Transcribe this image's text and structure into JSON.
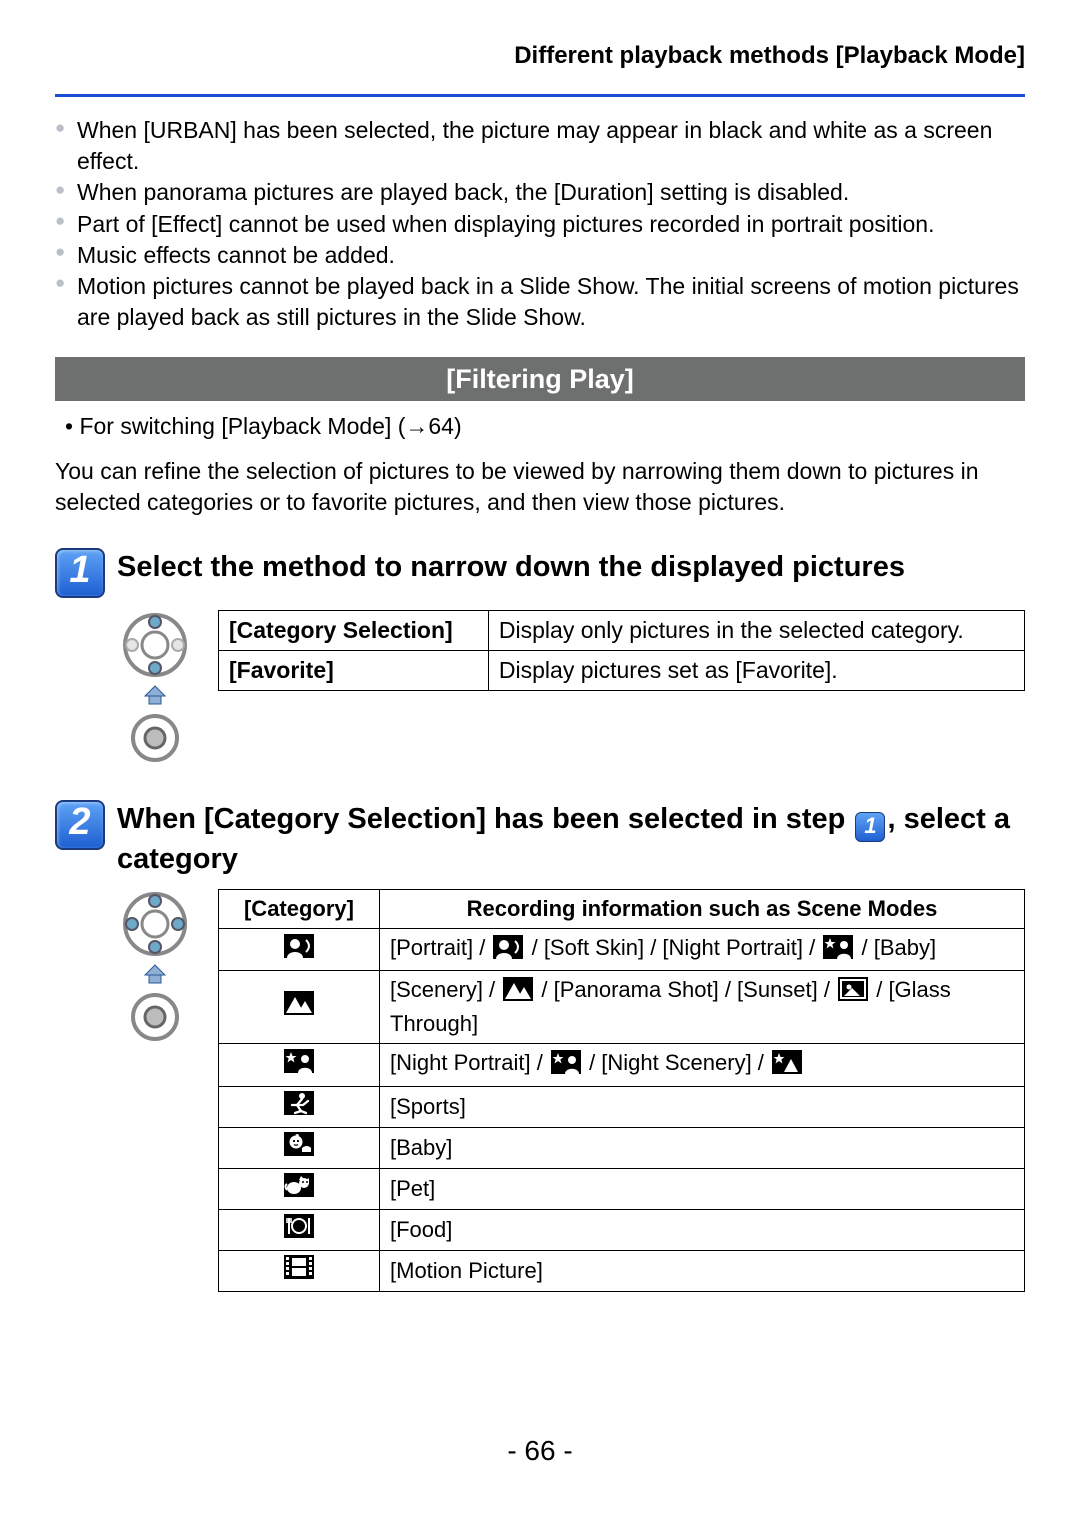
{
  "header": "Different playback methods  [Playback Mode]",
  "bullets": [
    "When [URBAN] has been selected, the picture may appear in black and white as a screen effect.",
    "When panorama pictures are played back, the [Duration] setting is disabled.",
    "Part of [Effect] cannot be used when displaying pictures recorded in portrait position.",
    "Music effects cannot be added.",
    "Motion pictures cannot be played back in a Slide Show. The initial screens of motion pictures are played back as still pictures in the Slide Show."
  ],
  "section_title": "[Filtering Play]",
  "sub_note": "• For switching [Playback Mode] (→64)",
  "intro_para": "You can refine the selection of pictures to be viewed by narrowing them down to pictures in selected categories or to favorite pictures, and then view those pictures.",
  "step1": {
    "num": "1",
    "title": "Select the method to narrow down the displayed pictures",
    "rows": [
      {
        "label": "[Category Selection]",
        "desc": "Display only pictures in the selected category."
      },
      {
        "label": "[Favorite]",
        "desc": "Display pictures set as [Favorite]."
      }
    ]
  },
  "step2": {
    "num": "2",
    "title_pre": "When [Category Selection] has been selected in step ",
    "inline_badge": "1",
    "title_post": ", select a category",
    "table_head": {
      "col1": "[Category]",
      "col2": "Recording information such as Scene Modes"
    },
    "rows": [
      {
        "icon": "portrait",
        "parts": [
          {
            "t": "text",
            "v": "[Portrait] / "
          },
          {
            "t": "icon",
            "v": "portrait"
          },
          {
            "t": "text",
            "v": " / [Soft Skin] / [Night Portrait] / "
          },
          {
            "t": "icon",
            "v": "night-portrait"
          },
          {
            "t": "text",
            "v": " / [Baby]"
          }
        ]
      },
      {
        "icon": "scenery",
        "parts": [
          {
            "t": "text",
            "v": "[Scenery] / "
          },
          {
            "t": "icon",
            "v": "scenery"
          },
          {
            "t": "text",
            "v": " / [Panorama Shot] / [Sunset] / "
          },
          {
            "t": "icon",
            "v": "sunset"
          },
          {
            "t": "text",
            "v": " / [Glass Through]"
          }
        ]
      },
      {
        "icon": "night-portrait",
        "parts": [
          {
            "t": "text",
            "v": "[Night Portrait] / "
          },
          {
            "t": "icon",
            "v": "night-portrait"
          },
          {
            "t": "text",
            "v": " / [Night Scenery] / "
          },
          {
            "t": "icon",
            "v": "night-scenery"
          }
        ]
      },
      {
        "icon": "sports",
        "parts": [
          {
            "t": "text",
            "v": "[Sports]"
          }
        ]
      },
      {
        "icon": "baby",
        "parts": [
          {
            "t": "text",
            "v": "[Baby]"
          }
        ]
      },
      {
        "icon": "pet",
        "parts": [
          {
            "t": "text",
            "v": "[Pet]"
          }
        ]
      },
      {
        "icon": "food",
        "parts": [
          {
            "t": "text",
            "v": "[Food]"
          }
        ]
      },
      {
        "icon": "motion",
        "parts": [
          {
            "t": "text",
            "v": "[Motion Picture]"
          }
        ]
      }
    ]
  },
  "page_number": "- 66 -"
}
